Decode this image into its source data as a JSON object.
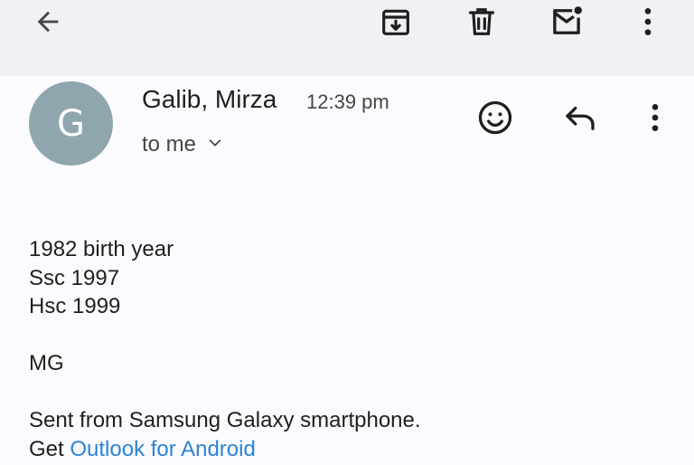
{
  "toolbar": {
    "back_icon": "arrow-back-icon",
    "archive_icon": "archive-icon",
    "delete_icon": "trash-icon",
    "mark_unread_icon": "mark-unread-icon",
    "more_icon": "more-vert-icon"
  },
  "message": {
    "avatar_initial": "G",
    "avatar_color": "#8fa6ae",
    "sender": "Galib, Mirza",
    "time": "12:39 pm",
    "recipient": "to me",
    "actions": {
      "react_icon": "emoji-icon",
      "reply_icon": "reply-icon",
      "more_icon": "more-vert-icon"
    }
  },
  "body": {
    "lines": [
      "1982 birth year",
      "Ssc 1997",
      "Hsc 1999"
    ],
    "signature": "MG",
    "footer": "Sent from Samsung Galaxy smartphone.",
    "get_prefix": "Get",
    "link_text": "Outlook for Android",
    "link_color": "#2b84d6"
  }
}
